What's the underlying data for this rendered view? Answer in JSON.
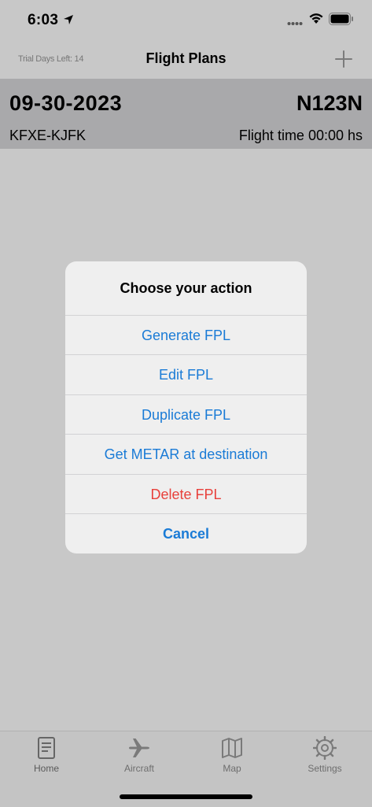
{
  "status_bar": {
    "time": "6:03",
    "icons": [
      "location-arrow-icon",
      "cellular-dots-icon",
      "wifi-icon",
      "battery-icon"
    ]
  },
  "nav": {
    "trial_text": "Trial Days Left: 14",
    "title": "Flight Plans",
    "add_icon": "plus-icon"
  },
  "flight": {
    "date": "09-30-2023",
    "registration": "N123N",
    "route": "KFXE-KJFK",
    "flight_time": "Flight time 00:00 hs"
  },
  "dialog": {
    "title": "Choose your action",
    "actions": [
      {
        "label": "Generate FPL"
      },
      {
        "label": "Edit FPL"
      },
      {
        "label": "Duplicate FPL"
      },
      {
        "label": "Get METAR at destination"
      },
      {
        "label": "Delete FPL"
      },
      {
        "label": "Cancel"
      }
    ]
  },
  "tabs": [
    {
      "label": "Home",
      "icon": "document-icon"
    },
    {
      "label": "Aircraft",
      "icon": "airplane-icon"
    },
    {
      "label": "Map",
      "icon": "map-icon"
    },
    {
      "label": "Settings",
      "icon": "gear-icon"
    }
  ],
  "colors": {
    "background": "#c8c8c8",
    "row_highlight": "#a9a9ab",
    "action_blue": "#1a7bd6",
    "destructive_red": "#e8403b"
  }
}
